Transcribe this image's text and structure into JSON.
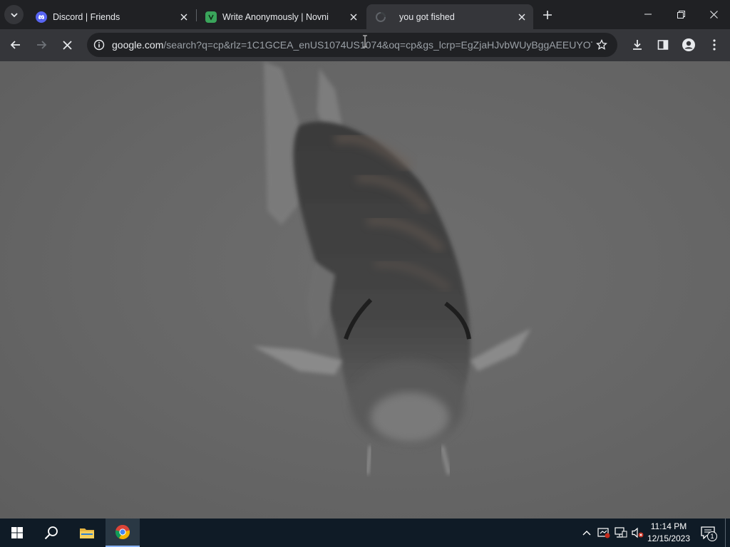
{
  "browser": {
    "tabs": [
      {
        "title": "Discord | Friends",
        "favicon": "discord-icon",
        "active": false
      },
      {
        "title": "Write Anonymously | Novni",
        "favicon": "novni-icon",
        "active": false
      },
      {
        "title": "you got fished",
        "favicon": "loading-icon",
        "active": true
      }
    ],
    "address": {
      "host": "google.com",
      "path": "/search?q=cp&rlz=1C1GCEA_enUS1074US1074&oq=cp&gs_lcrp=EgZjaHJvbWUyBggAEEUYOTI..."
    }
  },
  "page": {
    "title": "you got fished",
    "image": "fish-image"
  },
  "taskbar": {
    "time": "11:14 PM",
    "date": "12/15/2023",
    "notification_count": "1"
  },
  "colors": {
    "chrome_dark": "#202124",
    "toolbar": "#35363a",
    "taskbar": "#0f1b26",
    "discord": "#5865f2",
    "novni": "#3aa55b"
  }
}
